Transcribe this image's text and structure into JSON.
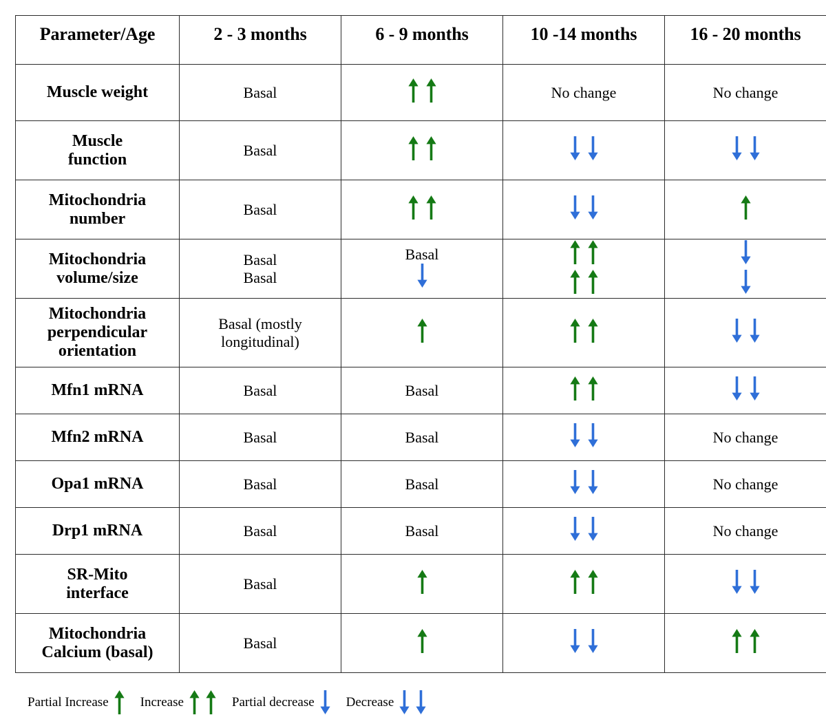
{
  "colors": {
    "increase_arrow": "#157a15",
    "decrease_arrow": "#2f6fd8",
    "border": "#2b2b2b",
    "text": "#000000",
    "background": "#ffffff"
  },
  "table": {
    "headers": [
      "Parameter/Age",
      "2 - 3 months",
      "6 - 9 months",
      "10 -14 months",
      "16 - 20 months"
    ],
    "rows": [
      {
        "parameter": [
          "Muscle weight"
        ],
        "cells": [
          {
            "lines": [
              {
                "text": "Basal"
              }
            ]
          },
          {
            "lines": [
              {
                "arrows": "up-up"
              }
            ]
          },
          {
            "lines": [
              {
                "text": "No change"
              }
            ]
          },
          {
            "lines": [
              {
                "text": "No change"
              }
            ]
          }
        ]
      },
      {
        "parameter": [
          "Muscle",
          "function"
        ],
        "cells": [
          {
            "lines": [
              {
                "text": "Basal"
              }
            ]
          },
          {
            "lines": [
              {
                "arrows": "up-up"
              }
            ]
          },
          {
            "lines": [
              {
                "arrows": "down-down"
              }
            ]
          },
          {
            "lines": [
              {
                "arrows": "down-down"
              }
            ]
          }
        ]
      },
      {
        "parameter": [
          "Mitochondria",
          "number"
        ],
        "cells": [
          {
            "lines": [
              {
                "text": "Basal"
              }
            ]
          },
          {
            "lines": [
              {
                "arrows": "up-up"
              }
            ]
          },
          {
            "lines": [
              {
                "arrows": "down-down"
              }
            ]
          },
          {
            "lines": [
              {
                "arrows": "up"
              }
            ]
          }
        ]
      },
      {
        "parameter": [
          "Mitochondria",
          "volume/size"
        ],
        "cells": [
          {
            "lines": [
              {
                "text": "Basal"
              },
              {
                "text": "Basal"
              }
            ]
          },
          {
            "lines": [
              {
                "text": "Basal"
              },
              {
                "arrows": "down"
              }
            ]
          },
          {
            "lines": [
              {
                "arrows": "up-up"
              },
              {
                "arrows": "up-up"
              }
            ]
          },
          {
            "lines": [
              {
                "arrows": "down"
              },
              {
                "arrows": "down"
              }
            ]
          }
        ]
      },
      {
        "parameter": [
          "Mitochondria",
          "perpendicular",
          "orientation"
        ],
        "cells": [
          {
            "lines": [
              {
                "text": "Basal (mostly"
              },
              {
                "text": "longitudinal)"
              }
            ]
          },
          {
            "lines": [
              {
                "arrows": "up"
              }
            ]
          },
          {
            "lines": [
              {
                "arrows": "up-up"
              }
            ]
          },
          {
            "lines": [
              {
                "arrows": "down-down"
              }
            ]
          }
        ]
      },
      {
        "parameter": [
          "Mfn1 mRNA"
        ],
        "cells": [
          {
            "lines": [
              {
                "text": "Basal"
              }
            ]
          },
          {
            "lines": [
              {
                "text": "Basal"
              }
            ]
          },
          {
            "lines": [
              {
                "arrows": "up-up"
              }
            ]
          },
          {
            "lines": [
              {
                "arrows": "down-down"
              }
            ]
          }
        ]
      },
      {
        "parameter": [
          "Mfn2 mRNA"
        ],
        "cells": [
          {
            "lines": [
              {
                "text": "Basal"
              }
            ]
          },
          {
            "lines": [
              {
                "text": "Basal"
              }
            ]
          },
          {
            "lines": [
              {
                "arrows": "down-down"
              }
            ]
          },
          {
            "lines": [
              {
                "text": "No change"
              }
            ]
          }
        ]
      },
      {
        "parameter": [
          "Opa1 mRNA"
        ],
        "cells": [
          {
            "lines": [
              {
                "text": "Basal"
              }
            ]
          },
          {
            "lines": [
              {
                "text": "Basal"
              }
            ]
          },
          {
            "lines": [
              {
                "arrows": "down-down"
              }
            ]
          },
          {
            "lines": [
              {
                "text": "No change"
              }
            ]
          }
        ]
      },
      {
        "parameter": [
          "Drp1 mRNA"
        ],
        "cells": [
          {
            "lines": [
              {
                "text": "Basal"
              }
            ]
          },
          {
            "lines": [
              {
                "text": "Basal"
              }
            ]
          },
          {
            "lines": [
              {
                "arrows": "down-down"
              }
            ]
          },
          {
            "lines": [
              {
                "text": "No change"
              }
            ]
          }
        ]
      },
      {
        "parameter": [
          "SR-Mito",
          "interface"
        ],
        "cells": [
          {
            "lines": [
              {
                "text": "Basal"
              }
            ]
          },
          {
            "lines": [
              {
                "arrows": "up"
              }
            ]
          },
          {
            "lines": [
              {
                "arrows": "up-up"
              }
            ]
          },
          {
            "lines": [
              {
                "arrows": "down-down"
              }
            ]
          }
        ]
      },
      {
        "parameter": [
          "Mitochondria",
          "Calcium (basal)"
        ],
        "cells": [
          {
            "lines": [
              {
                "text": "Basal"
              }
            ]
          },
          {
            "lines": [
              {
                "arrows": "up"
              }
            ]
          },
          {
            "lines": [
              {
                "arrows": "down-down"
              }
            ]
          },
          {
            "lines": [
              {
                "arrows": "up-up"
              }
            ]
          }
        ]
      }
    ]
  },
  "legend": {
    "items": [
      {
        "label": "Partial Increase",
        "arrows": "up"
      },
      {
        "label": "Increase",
        "arrows": "up-up"
      },
      {
        "label": "Partial decrease",
        "arrows": "down"
      },
      {
        "label": "Decrease",
        "arrows": "down-down"
      }
    ]
  },
  "icons": {
    "up": "up-arrow-icon",
    "up-up": "double-up-arrow-icon",
    "down": "down-arrow-icon",
    "down-down": "double-down-arrow-icon"
  }
}
